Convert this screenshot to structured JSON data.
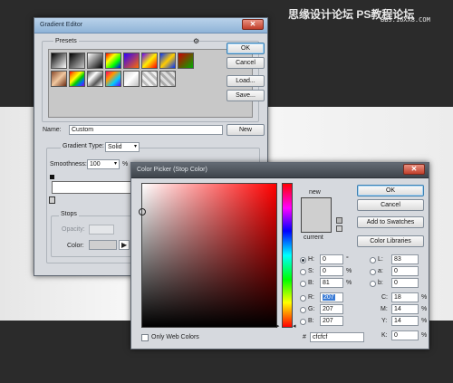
{
  "watermark": {
    "line1": "思缘设计论坛 PS教程论坛",
    "line2": "BBS.16XX8.COM"
  },
  "gradient_editor": {
    "title": "Gradient Editor",
    "presets_label": "Presets",
    "ok": "OK",
    "cancel": "Cancel",
    "load": "Load...",
    "save": "Save...",
    "name_label": "Name:",
    "name_value": "Custom",
    "new_button": "New",
    "gradient_type_label": "Gradient Type:",
    "gradient_type_value": "Solid",
    "smoothness_label": "Smoothness:",
    "smoothness_value": "100",
    "smoothness_unit": "%",
    "stops_label": "Stops",
    "opacity_label": "Opacity:",
    "color_label": "Color:",
    "stop_color": "#cfcfcf"
  },
  "color_picker": {
    "title": "Color Picker (Stop Color)",
    "new_label": "new",
    "current_label": "current",
    "new_color": "#cfcfcf",
    "current_color": "#cfcfcf",
    "hue_color": "#ff0000",
    "ok": "OK",
    "cancel": "Cancel",
    "add_to_swatches": "Add to Swatches",
    "color_libraries": "Color Libraries",
    "only_web_colors": "Only Web Colors",
    "hex_prefix": "#",
    "hex_value": "cfcfcf",
    "hsb": [
      {
        "label": "H:",
        "value": "0",
        "unit": "°"
      },
      {
        "label": "S:",
        "value": "0",
        "unit": "%"
      },
      {
        "label": "B:",
        "value": "81",
        "unit": "%"
      }
    ],
    "rgb": [
      {
        "label": "R:",
        "value": "207"
      },
      {
        "label": "G:",
        "value": "207"
      },
      {
        "label": "B:",
        "value": "207"
      }
    ],
    "lab": [
      {
        "label": "L:",
        "value": "83"
      },
      {
        "label": "a:",
        "value": "0"
      },
      {
        "label": "b:",
        "value": "0"
      }
    ],
    "cmyk": [
      {
        "label": "C:",
        "value": "18",
        "unit": "%"
      },
      {
        "label": "M:",
        "value": "14",
        "unit": "%"
      },
      {
        "label": "Y:",
        "value": "14",
        "unit": "%"
      },
      {
        "label": "K:",
        "value": "0",
        "unit": "%"
      }
    ]
  }
}
